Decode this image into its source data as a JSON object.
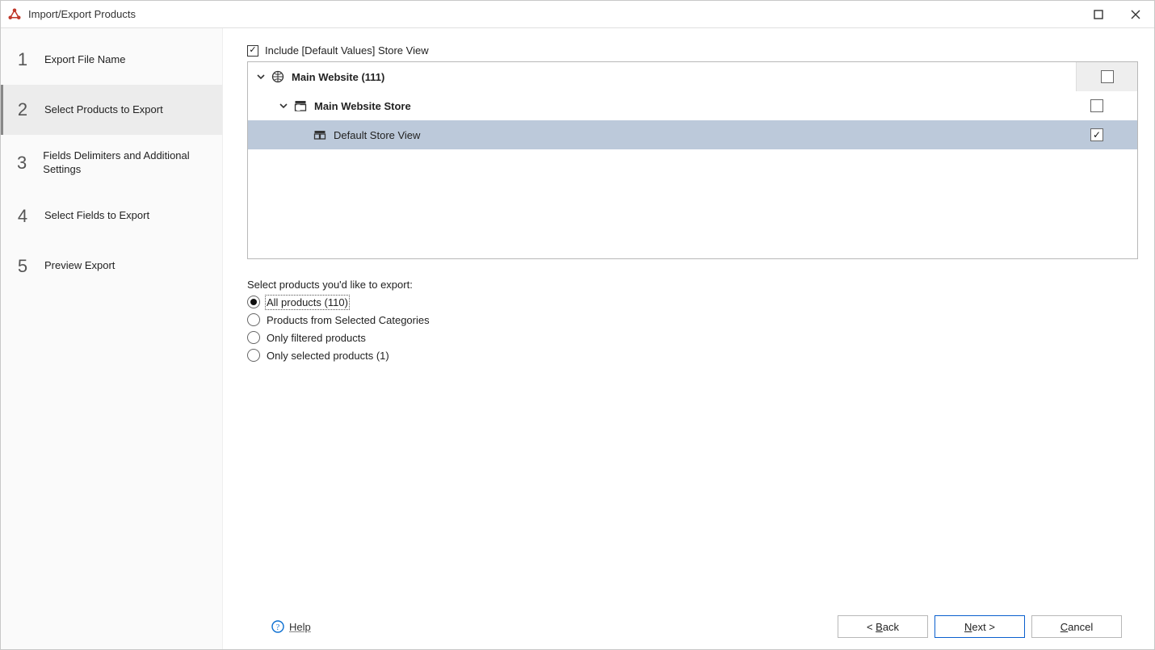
{
  "window": {
    "title": "Import/Export Products"
  },
  "sidebar": {
    "steps": [
      {
        "num": "1",
        "label": "Export File Name"
      },
      {
        "num": "2",
        "label": "Select Products to Export"
      },
      {
        "num": "3",
        "label": "Fields Delimiters and Additional Settings"
      },
      {
        "num": "4",
        "label": "Select Fields to Export"
      },
      {
        "num": "5",
        "label": "Preview Export"
      }
    ],
    "activeIndex": 1
  },
  "include": {
    "label": "Include [Default Values] Store View",
    "checked": true
  },
  "tree": {
    "root": {
      "label": "Main Website (111)",
      "checked": false,
      "expanded": true
    },
    "store": {
      "label": "Main Website Store",
      "checked": false,
      "expanded": true
    },
    "view": {
      "label": "Default Store View",
      "checked": true,
      "selected": true
    }
  },
  "selectPrompt": "Select products you'd like to export:",
  "radios": [
    {
      "label": "All products (110)",
      "checked": true
    },
    {
      "label": "Products from Selected Categories",
      "checked": false
    },
    {
      "label": "Only filtered products",
      "checked": false
    },
    {
      "label": "Only selected products (1)",
      "checked": false
    }
  ],
  "footer": {
    "help": "Help",
    "back": "Back",
    "next": "Next",
    "cancel": "Cancel"
  }
}
